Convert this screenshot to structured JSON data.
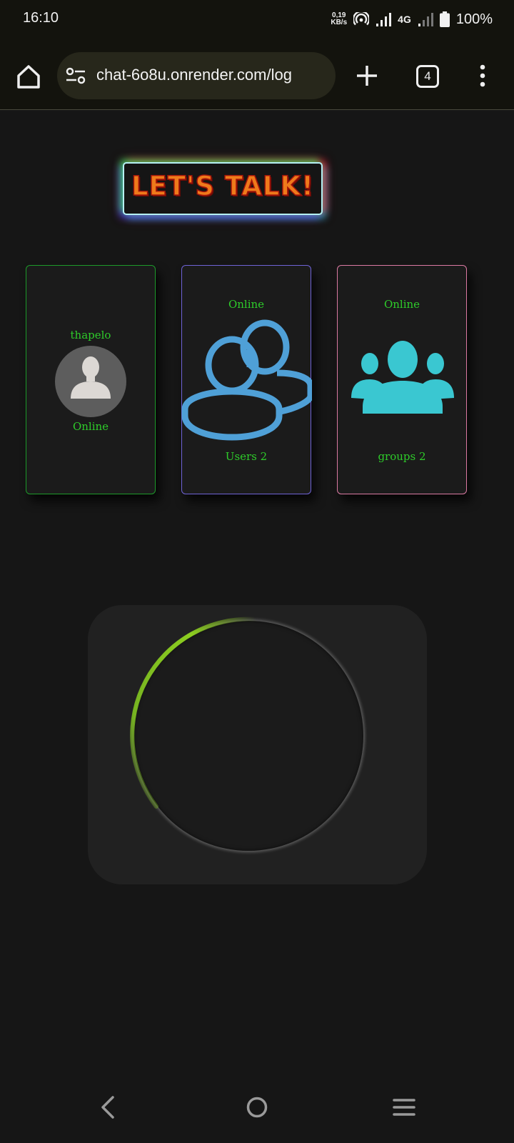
{
  "status_bar": {
    "time": "16:10",
    "net_speed_value": "0,19",
    "net_speed_unit": "KB/s",
    "network_type": "4G",
    "battery": "100%"
  },
  "browser": {
    "url": "chat-6o8u.onrender.com/log",
    "tab_count": "4",
    "icons": [
      "home-icon",
      "site-settings-icon",
      "new-tab-plus-icon",
      "tab-switcher-icon",
      "more-menu-icon"
    ]
  },
  "page": {
    "logo_text": "LET'S TALK!",
    "profile_card": {
      "name": "thapelo",
      "status": "Online",
      "icon": "user-avatar-icon"
    },
    "users_card": {
      "status": "Online",
      "label": "Users 2",
      "icon": "users-icon"
    },
    "groups_card": {
      "status": "Online",
      "label": "groups 2",
      "icon": "groups-icon"
    },
    "colors": {
      "background": "#161616",
      "status_text": "#2ecb2a",
      "users_icon": "#4fa0d7",
      "groups_icon": "#3ac7d1",
      "spinner_accent": "#7dc01e"
    }
  },
  "system_nav": {
    "icons": [
      "back-icon",
      "home-circle-icon",
      "recents-icon"
    ]
  }
}
